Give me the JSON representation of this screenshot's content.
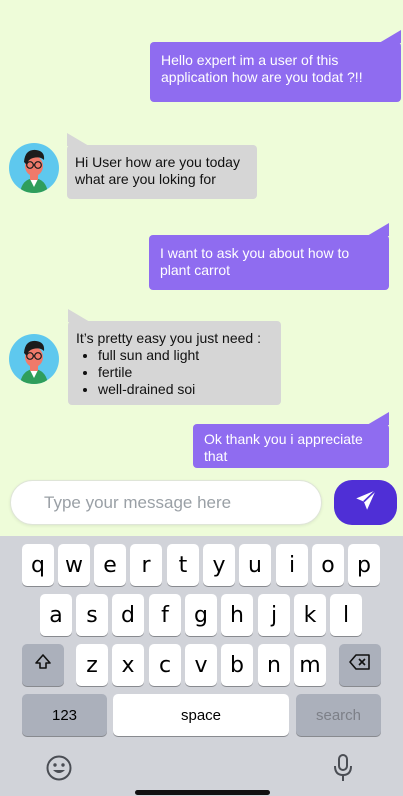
{
  "messages": [
    {
      "from": "user",
      "text": "Hello expert im a user of this application how are you todat ?!!"
    },
    {
      "from": "bot",
      "text": "Hi User how are you today what are you loking for"
    },
    {
      "from": "user",
      "text": "I want to ask you about how to plant carrot"
    },
    {
      "from": "bot",
      "intro": "It’s pretty easy you just need :",
      "items": [
        "full sun and light",
        "fertile",
        "well-drained soi"
      ]
    },
    {
      "from": "user",
      "text": "Ok thank you i appreciate that"
    }
  ],
  "input": {
    "placeholder": "Type your message here"
  },
  "keyboard": {
    "row1": [
      "q",
      "w",
      "e",
      "r",
      "t",
      "y",
      "u",
      "i",
      "o",
      "p"
    ],
    "row2": [
      "a",
      "s",
      "d",
      "f",
      "g",
      "h",
      "j",
      "k",
      "l"
    ],
    "row3": [
      "z",
      "x",
      "c",
      "v",
      "b",
      "n",
      "m"
    ],
    "numbers_label": "123",
    "space_label": "space",
    "search_label": "search"
  },
  "icons": {
    "send": "send-icon",
    "shift": "shift-icon",
    "backspace": "backspace-icon",
    "emoji": "emoji-icon",
    "microphone": "microphone-icon"
  },
  "colors": {
    "background": "#eefcd9",
    "user_bubble": "#8f6cf0",
    "bot_bubble": "#d6d6d6",
    "send_button": "#4f2fd6",
    "avatar_bg": "#5ec8ee",
    "keyboard_bg": "#d1d3d9"
  }
}
